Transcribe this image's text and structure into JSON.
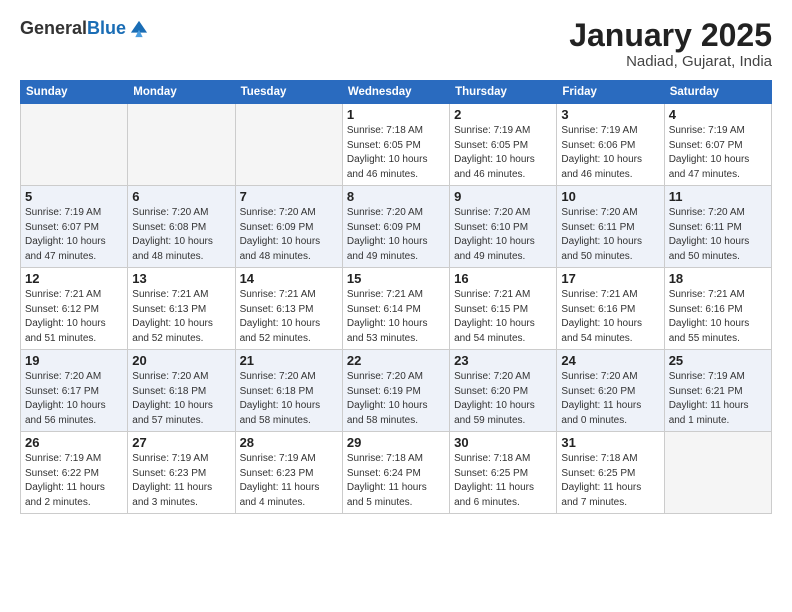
{
  "header": {
    "logo_general": "General",
    "logo_blue": "Blue",
    "title": "January 2025",
    "subtitle": "Nadiad, Gujarat, India"
  },
  "days_of_week": [
    "Sunday",
    "Monday",
    "Tuesday",
    "Wednesday",
    "Thursday",
    "Friday",
    "Saturday"
  ],
  "weeks": [
    [
      {
        "day": "",
        "detail": ""
      },
      {
        "day": "",
        "detail": ""
      },
      {
        "day": "",
        "detail": ""
      },
      {
        "day": "1",
        "detail": "Sunrise: 7:18 AM\nSunset: 6:05 PM\nDaylight: 10 hours\nand 46 minutes."
      },
      {
        "day": "2",
        "detail": "Sunrise: 7:19 AM\nSunset: 6:05 PM\nDaylight: 10 hours\nand 46 minutes."
      },
      {
        "day": "3",
        "detail": "Sunrise: 7:19 AM\nSunset: 6:06 PM\nDaylight: 10 hours\nand 46 minutes."
      },
      {
        "day": "4",
        "detail": "Sunrise: 7:19 AM\nSunset: 6:07 PM\nDaylight: 10 hours\nand 47 minutes."
      }
    ],
    [
      {
        "day": "5",
        "detail": "Sunrise: 7:19 AM\nSunset: 6:07 PM\nDaylight: 10 hours\nand 47 minutes."
      },
      {
        "day": "6",
        "detail": "Sunrise: 7:20 AM\nSunset: 6:08 PM\nDaylight: 10 hours\nand 48 minutes."
      },
      {
        "day": "7",
        "detail": "Sunrise: 7:20 AM\nSunset: 6:09 PM\nDaylight: 10 hours\nand 48 minutes."
      },
      {
        "day": "8",
        "detail": "Sunrise: 7:20 AM\nSunset: 6:09 PM\nDaylight: 10 hours\nand 49 minutes."
      },
      {
        "day": "9",
        "detail": "Sunrise: 7:20 AM\nSunset: 6:10 PM\nDaylight: 10 hours\nand 49 minutes."
      },
      {
        "day": "10",
        "detail": "Sunrise: 7:20 AM\nSunset: 6:11 PM\nDaylight: 10 hours\nand 50 minutes."
      },
      {
        "day": "11",
        "detail": "Sunrise: 7:20 AM\nSunset: 6:11 PM\nDaylight: 10 hours\nand 50 minutes."
      }
    ],
    [
      {
        "day": "12",
        "detail": "Sunrise: 7:21 AM\nSunset: 6:12 PM\nDaylight: 10 hours\nand 51 minutes."
      },
      {
        "day": "13",
        "detail": "Sunrise: 7:21 AM\nSunset: 6:13 PM\nDaylight: 10 hours\nand 52 minutes."
      },
      {
        "day": "14",
        "detail": "Sunrise: 7:21 AM\nSunset: 6:13 PM\nDaylight: 10 hours\nand 52 minutes."
      },
      {
        "day": "15",
        "detail": "Sunrise: 7:21 AM\nSunset: 6:14 PM\nDaylight: 10 hours\nand 53 minutes."
      },
      {
        "day": "16",
        "detail": "Sunrise: 7:21 AM\nSunset: 6:15 PM\nDaylight: 10 hours\nand 54 minutes."
      },
      {
        "day": "17",
        "detail": "Sunrise: 7:21 AM\nSunset: 6:16 PM\nDaylight: 10 hours\nand 54 minutes."
      },
      {
        "day": "18",
        "detail": "Sunrise: 7:21 AM\nSunset: 6:16 PM\nDaylight: 10 hours\nand 55 minutes."
      }
    ],
    [
      {
        "day": "19",
        "detail": "Sunrise: 7:20 AM\nSunset: 6:17 PM\nDaylight: 10 hours\nand 56 minutes."
      },
      {
        "day": "20",
        "detail": "Sunrise: 7:20 AM\nSunset: 6:18 PM\nDaylight: 10 hours\nand 57 minutes."
      },
      {
        "day": "21",
        "detail": "Sunrise: 7:20 AM\nSunset: 6:18 PM\nDaylight: 10 hours\nand 58 minutes."
      },
      {
        "day": "22",
        "detail": "Sunrise: 7:20 AM\nSunset: 6:19 PM\nDaylight: 10 hours\nand 58 minutes."
      },
      {
        "day": "23",
        "detail": "Sunrise: 7:20 AM\nSunset: 6:20 PM\nDaylight: 10 hours\nand 59 minutes."
      },
      {
        "day": "24",
        "detail": "Sunrise: 7:20 AM\nSunset: 6:20 PM\nDaylight: 11 hours\nand 0 minutes."
      },
      {
        "day": "25",
        "detail": "Sunrise: 7:19 AM\nSunset: 6:21 PM\nDaylight: 11 hours\nand 1 minute."
      }
    ],
    [
      {
        "day": "26",
        "detail": "Sunrise: 7:19 AM\nSunset: 6:22 PM\nDaylight: 11 hours\nand 2 minutes."
      },
      {
        "day": "27",
        "detail": "Sunrise: 7:19 AM\nSunset: 6:23 PM\nDaylight: 11 hours\nand 3 minutes."
      },
      {
        "day": "28",
        "detail": "Sunrise: 7:19 AM\nSunset: 6:23 PM\nDaylight: 11 hours\nand 4 minutes."
      },
      {
        "day": "29",
        "detail": "Sunrise: 7:18 AM\nSunset: 6:24 PM\nDaylight: 11 hours\nand 5 minutes."
      },
      {
        "day": "30",
        "detail": "Sunrise: 7:18 AM\nSunset: 6:25 PM\nDaylight: 11 hours\nand 6 minutes."
      },
      {
        "day": "31",
        "detail": "Sunrise: 7:18 AM\nSunset: 6:25 PM\nDaylight: 11 hours\nand 7 minutes."
      },
      {
        "day": "",
        "detail": ""
      }
    ]
  ]
}
